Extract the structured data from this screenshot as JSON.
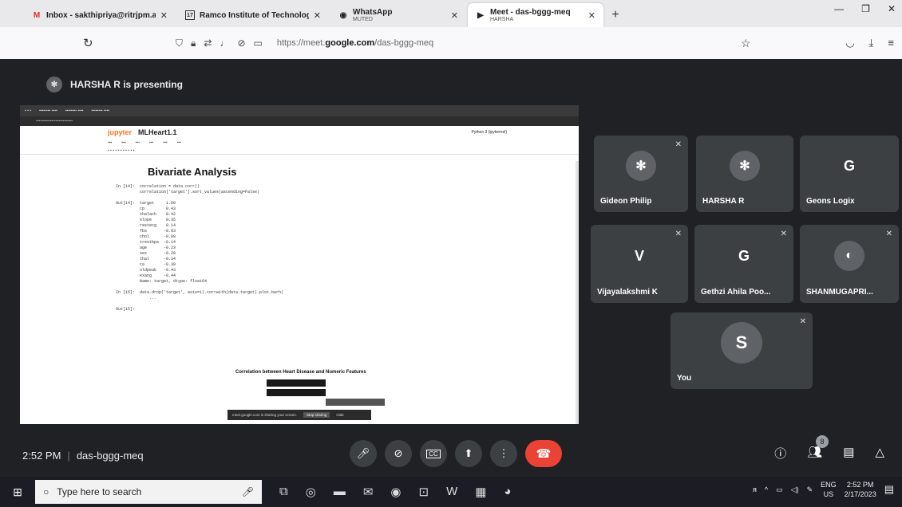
{
  "browser": {
    "tabs": [
      {
        "icon": "gmail-icon",
        "label": "Inbox - sakthipriya@ritrjpm.ac",
        "sub": ""
      },
      {
        "icon": "college-icon",
        "label": "Ramco Institute of Technolog",
        "sub": ""
      },
      {
        "icon": "whatsapp-icon",
        "label": "WhatsApp",
        "sub": "MUTED"
      },
      {
        "icon": "meet-icon",
        "label": "Meet - das-bggg-meq",
        "sub": "HARSHA"
      }
    ],
    "url_prefix": "https://meet.",
    "url_domain": "google.com",
    "url_path": "/das-bggg-meq"
  },
  "meet": {
    "presenting_text": "HARSHA R is presenting",
    "meeting_code": "das-bggg-meq",
    "time": "2:52 PM",
    "participant_count": "8",
    "participants": [
      {
        "name": "Gideon Philip",
        "avatar": "photo",
        "muted": true
      },
      {
        "name": "HARSHA R",
        "avatar": "photo",
        "muted": false
      },
      {
        "name": "Geons Logix",
        "avatar": "G",
        "muted": false
      },
      {
        "name": "Vijayalakshmi K",
        "avatar": "V",
        "muted": true
      },
      {
        "name": "Gethzi Ahila Poo...",
        "avatar": "G",
        "muted": true
      },
      {
        "name": "SHANMUGAPRI...",
        "avatar": "photo",
        "muted": true
      },
      {
        "name": "You",
        "avatar": "S",
        "muted": true
      }
    ]
  },
  "shared_screen": {
    "jupyter_logo": "jupyter",
    "notebook_name": "MLHeart1.1",
    "kernel": "Python 3 (ipykernel)",
    "heading": "Bivariate Analysis",
    "code_lines": [
      "In [14]:  correlation = data.corr()",
      "          correlation['target'].sort_values(ascending=False)",
      "",
      "Out[14]:  target     1.00",
      "          cp         0.43",
      "          thalach    0.42",
      "          slope      0.35",
      "          restecg    0.14",
      "          fbs       -0.03",
      "          chol      -0.09",
      "          trestbps  -0.14",
      "          age       -0.23",
      "          sex       -0.28",
      "          thal      -0.34",
      "          ca        -0.39",
      "          oldpeak   -0.43",
      "          exang     -0.44",
      "          Name: target, dtype: float64",
      "",
      "In [15]:  data.drop('target', axis=1).corrwith(data.target).plot.barh(",
      "              ...",
      "",
      "Out[15]:"
    ],
    "chart_title": "Correlation between Heart Disease and Numeric Features",
    "notice_text": "meet.google.com is sharing your screen.",
    "notice_button": "Stop sharing",
    "notice_hide": "Hide"
  },
  "taskbar": {
    "search_placeholder": "Type here to search",
    "lang": "ENG",
    "region": "US",
    "clock_time": "2:52 PM",
    "clock_date": "2/17/2023"
  }
}
